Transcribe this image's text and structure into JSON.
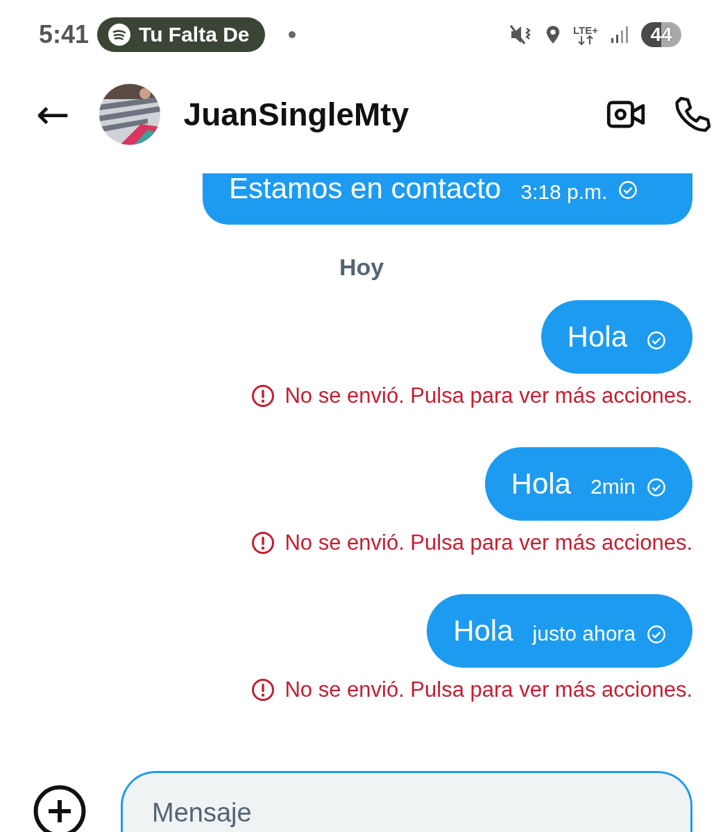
{
  "status_bar": {
    "time": "5:41",
    "media_pill": {
      "label": "Tu Falta De"
    },
    "network": "LTE+",
    "battery": "44"
  },
  "header": {
    "back": "←",
    "contact_name": "JuanSingleMty"
  },
  "messages": [
    {
      "kind": "bubble",
      "text": "Estamos en contacto",
      "time": "3:18 p.m.",
      "failed": false,
      "clipped": true
    },
    {
      "kind": "day",
      "text": "Hoy"
    },
    {
      "kind": "bubble",
      "text": "Hola",
      "failed": true,
      "error": "No se envió. Pulsa para ver más acciones."
    },
    {
      "kind": "bubble",
      "text": "Hola",
      "time": "2min",
      "failed": true,
      "error": "No se envió. Pulsa para ver más acciones."
    },
    {
      "kind": "bubble",
      "text": "Hola",
      "time": "justo ahora",
      "failed": true,
      "error": "No se envió. Pulsa para ver más acciones."
    }
  ],
  "composer": {
    "placeholder": "Mensaje"
  }
}
